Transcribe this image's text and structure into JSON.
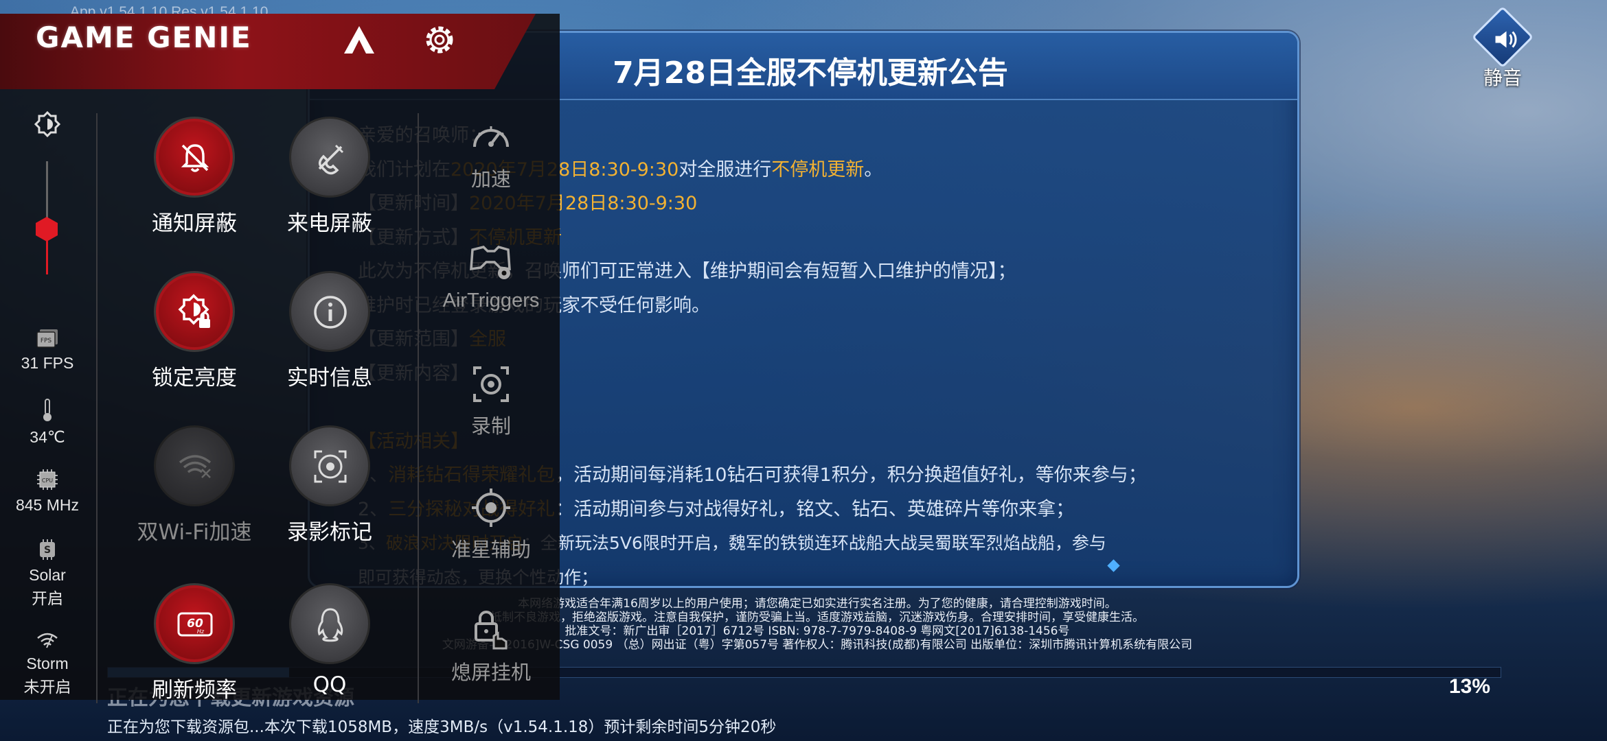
{
  "game": {
    "version": "App v1.54.1.10   Res v1.54.1.10",
    "mute_label": "静音",
    "announcement": {
      "title": "7月28日全服不停机更新公告",
      "lines": [
        [
          {
            "t": "亲爱的召唤师：",
            "c": ""
          }
        ],
        [
          {
            "t": "我们计划在",
            "c": ""
          },
          {
            "t": "2020年7月28日8:30-9:30",
            "c": "hl"
          },
          {
            "t": "对全服进行",
            "c": ""
          },
          {
            "t": "不停机更新",
            "c": "hl"
          },
          {
            "t": "。",
            "c": ""
          }
        ],
        [
          {
            "t": "【更新时间】",
            "c": ""
          },
          {
            "t": "2020年7月28日8:30-9:30",
            "c": "hl"
          }
        ],
        [
          {
            "t": "【更新方式】",
            "c": ""
          },
          {
            "t": "不停机更新",
            "c": "hl"
          }
        ],
        [
          {
            "t": "此次为不停机更新，召唤师们可正常进入【维护期间会有短暂入口维护的情况】；",
            "c": ""
          }
        ],
        [
          {
            "t": "维护时已经登录游戏的玩家不受任何影响。",
            "c": ""
          }
        ],
        [
          {
            "t": "【更新范围】",
            "c": ""
          },
          {
            "t": "全服",
            "c": "hl"
          }
        ],
        [
          {
            "t": "【更新内容】",
            "c": ""
          }
        ],
        [
          {
            "t": "",
            "c": ""
          }
        ],
        [
          {
            "t": "【活动相关】",
            "c": "hl"
          }
        ],
        [
          {
            "t": "1、",
            "c": ""
          },
          {
            "t": "消耗钻石得荣耀礼包",
            "c": "hl"
          },
          {
            "t": "，活动期间每消耗10钻石可获得1积分，积分换超值好礼，等你来参与；",
            "c": ""
          }
        ],
        [
          {
            "t": "2、",
            "c": ""
          },
          {
            "t": "三分探秘对战得好礼",
            "c": "hl"
          },
          {
            "t": "：活动期间参与对战得好礼，铭文、钻石、英雄碎片等你来拿；",
            "c": ""
          }
        ],
        [
          {
            "t": "3、",
            "c": ""
          },
          {
            "t": "破浪对决限时开启",
            "c": "hl"
          },
          {
            "t": "：全新玩法5V6限时开启，魏军的铁锁连环战船大战吴蜀联军烈焰战船，参与",
            "c": ""
          }
        ],
        [
          {
            "t": "即可获得动态，更换个性动作；",
            "c": ""
          }
        ]
      ]
    },
    "legal": [
      "本网络游戏适合年满16周岁以上的用户使用；请您确定已如实进行实名注册。为了您的健康，请合理控制游戏时间。",
      "抵制不良游戏，拒绝盗版游戏。注意自我保护，谨防受骗上当。适度游戏益脑，沉迷游戏伤身。合理安排时间，享受健康生活。",
      "批准文号：新广出审［2017］6712号 ISBN: 978-7-7979-8408-9 粤网文[2017]6138-1456号",
      "文网游备字[2016]W-CSG 0059 （总）网出证（粤）字第057号 著作权人：腾讯科技(成都)有限公司 出版单位：深圳市腾讯计算机系统有限公司"
    ],
    "progress": {
      "percent_label": "13%",
      "fraction": 0.13
    },
    "status_title": "正在为您下载更新游戏资源",
    "status_detail": "正在为您下载资源包...本次下载1058MB，速度3MB/s（v1.54.1.18）预计剩余时间5分钟20秒"
  },
  "genie": {
    "title": "GAME GENIE",
    "stats": {
      "fps": "31 FPS",
      "temp": "34℃",
      "cpu": "845 MHz",
      "solar_name": "Solar",
      "solar_state": "开启",
      "storm_name": "Storm",
      "storm_state": "未开启"
    },
    "brightness_level": 0.4,
    "toggles": {
      "notify_block": "通知屏蔽",
      "call_block": "来电屏蔽",
      "lock_brightness": "锁定亮度",
      "realtime_info": "实时信息",
      "dual_wifi": "双Wi-Fi加速",
      "record_marker": "录影标记",
      "refresh_rate": "刷新频率",
      "qq": "QQ"
    },
    "tools": {
      "boost": "加速",
      "airtriggers": "AirTriggers",
      "record": "录制",
      "crosshair": "准星辅助",
      "screen_off": "熄屏挂机"
    },
    "colors": {
      "accent": "#c0151d",
      "header": "#8d1218"
    }
  }
}
